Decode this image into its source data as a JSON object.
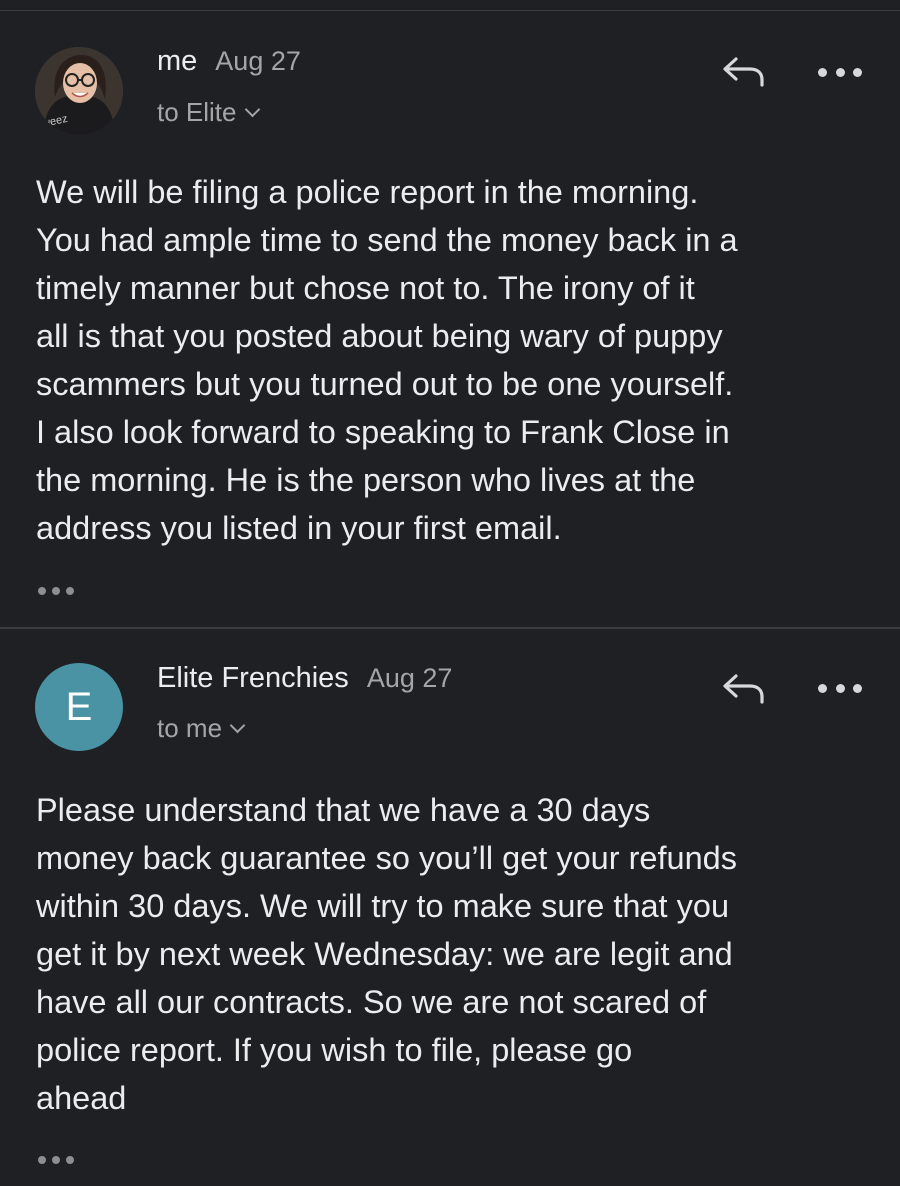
{
  "messages": [
    {
      "sender": "me",
      "date": "Aug 27",
      "recipient": "to Elite",
      "avatar_type": "photo",
      "avatar_caption": "weez",
      "body": "We will be filing a police report in the morning.\nYou had ample time to send the money back in a\ntimely manner but chose not to. The irony of it\nall is that you posted about being wary of puppy\nscammers but you turned out to be one yourself.\nI also look forward to speaking to Frank Close in\nthe morning. He is the person who lives at the\naddress you listed in your first email."
    },
    {
      "sender": "Elite Frenchies",
      "date": "Aug 27",
      "recipient": "to me",
      "avatar_type": "letter",
      "avatar_letter": "E",
      "avatar_color": "#4a93a5",
      "body": "Please understand that we have a 30 days\nmoney back guarantee so you’ll get your refunds\nwithin 30 days. We will try to make sure that you\nget it by next week Wednesday: we are legit and\nhave all our contracts. So we are not scared of\npolice report. If you wish to file, please go\nahead"
    }
  ],
  "icons": {
    "reply": "reply-icon",
    "more": "more-options-icon",
    "expand": "show-trimmed-content-icon",
    "recipient_toggle": "chevron-down-icon"
  },
  "colors": {
    "background": "#1f2024",
    "text_primary": "#ececee",
    "text_secondary": "#a4a5ab",
    "avatar_accent": "#4a93a5"
  }
}
